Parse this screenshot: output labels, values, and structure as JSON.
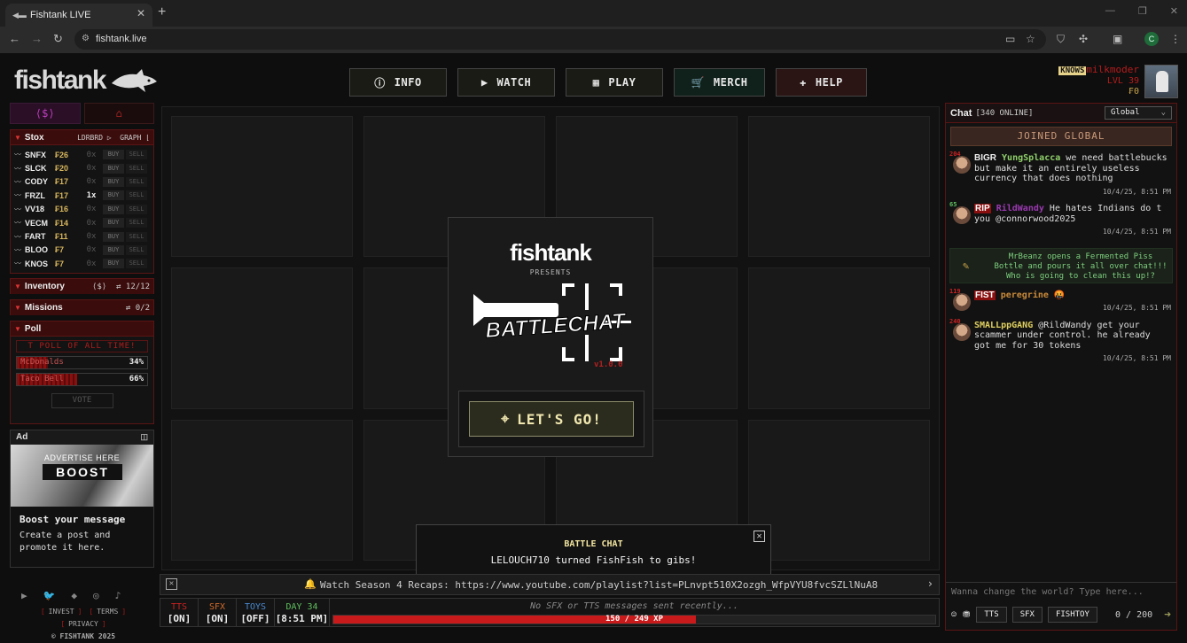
{
  "browser": {
    "tab_title": "Fishtank LIVE",
    "url": "fishtank.live"
  },
  "app": {
    "logo": "fishtank"
  },
  "nav": [
    {
      "label": "INFO",
      "icon": "info-icon",
      "glyph": "ⓘ"
    },
    {
      "label": "WATCH",
      "icon": "video-camera-icon",
      "glyph": "▶"
    },
    {
      "label": "PLAY",
      "icon": "checker-icon",
      "glyph": "▦"
    },
    {
      "label": "MERCH",
      "icon": "cart-icon",
      "glyph": "🛒"
    },
    {
      "label": "HELP",
      "icon": "help-icon",
      "glyph": "✚"
    }
  ],
  "nav_colors": [
    "#1b1b15",
    "#1b1b15",
    "#1b1b15",
    "#10201a",
    "#2a1414"
  ],
  "user": {
    "badge": "KNOWS",
    "name": "milkmoder",
    "level": "LVL 39",
    "coins": "₣0"
  },
  "stox": {
    "title": "Stox",
    "leaderboard": "LDRBRD ▷",
    "graph": "GRAPH ⌊",
    "rows": [
      {
        "sym": "SNFX",
        "price": "₣26",
        "qty": "0x",
        "own": false
      },
      {
        "sym": "SLCK",
        "price": "₣20",
        "qty": "0x",
        "own": false
      },
      {
        "sym": "CODY",
        "price": "₣17",
        "qty": "0x",
        "own": false
      },
      {
        "sym": "FRZL",
        "price": "₣17",
        "qty": "1x",
        "own": true
      },
      {
        "sym": "VV18",
        "price": "₣16",
        "qty": "0x",
        "own": false
      },
      {
        "sym": "VECM",
        "price": "₣14",
        "qty": "0x",
        "own": false
      },
      {
        "sym": "FART",
        "price": "₣11",
        "qty": "0x",
        "own": false
      },
      {
        "sym": "BLOO",
        "price": "₣7",
        "qty": "0x",
        "own": false
      },
      {
        "sym": "KNOS",
        "price": "₣7",
        "qty": "0x",
        "own": false
      }
    ],
    "buy": "BUY",
    "sell": "SELL"
  },
  "inventory": {
    "title": "Inventory",
    "count": "12/12"
  },
  "missions": {
    "title": "Missions",
    "count": "0/2"
  },
  "poll": {
    "title": "Poll",
    "question": "T POLL OF ALL TIME!",
    "options": [
      {
        "label": "McDonalds",
        "pct": "34%",
        "fraction": 0.34
      },
      {
        "label": "Taco Bell",
        "pct": "66%",
        "fraction": 0.66
      }
    ],
    "vote": "VOTE"
  },
  "ad": {
    "header": "Ad",
    "img_line1": "ADVERTISE HERE",
    "img_line2": "BOOST",
    "title": "Boost your message",
    "text": "Create a post and promote it here."
  },
  "footer": {
    "invest": "INVEST",
    "terms": "TERMS",
    "privacy": "PRIVACY",
    "copy": "© FISHTANK 2025"
  },
  "modal": {
    "logo": "fishtank",
    "presents": "PRESENTS",
    "art_text": "BATTLECHAT",
    "version": "v1.0.0",
    "button": "LET'S GO!"
  },
  "toast": {
    "title": "BATTLE CHAT",
    "message": "LELOUCH710 turned FishFish to gibs!"
  },
  "ticker": {
    "text": "Watch Season 4 Recaps: https://www.youtube.com/playlist?list=PLnvpt510X2ozgh_WfpVYU8fvcSZLlNuA8"
  },
  "status": {
    "tts": {
      "label": "TTS",
      "value": "[ON]",
      "color": "#c22"
    },
    "sfx": {
      "label": "SFX",
      "value": "[ON]",
      "color": "#d06a2a"
    },
    "toys": {
      "label": "TOYS",
      "value": "[OFF]",
      "color": "#4a8ad0"
    },
    "day": {
      "label": "DAY 34",
      "value": "[8:51 PM]",
      "color": "#5fbf5f"
    },
    "message": "No SFX or TTS messages sent recently...",
    "xp": "150 / 249 XP",
    "xp_fraction": 0.602
  },
  "chat": {
    "title": "Chat",
    "online": "[340 ONLINE]",
    "channel": "Global",
    "joined": "JOINED GLOBAL",
    "messages": [
      {
        "lvl": "204",
        "lvlColor": "red",
        "badge": "BIGR",
        "badgeStyle": "plain",
        "user": "YungSplacca",
        "userColor": "#8fd06a",
        "text": "we need battlebucks but make it an entirely useless currency that does nothing",
        "time": "10/4/25, 8:51 PM"
      },
      {
        "lvl": "65",
        "lvlColor": "green",
        "badge": "RIP",
        "badgeStyle": "red",
        "user": "RildWandy",
        "userColor": "#9a3ab0",
        "text": "He hates Indians do t you @connorwood2025",
        "time": "10/4/25, 8:51 PM"
      },
      {
        "lvl": "119",
        "lvlColor": "red",
        "badge": "FIST",
        "badgeStyle": "red",
        "user": "peregrine",
        "userColor": "#c98a3a",
        "text": "🤬",
        "time": "10/4/25, 8:51 PM"
      },
      {
        "lvl": "240",
        "lvlColor": "red",
        "badge": "",
        "badgeStyle": "plain",
        "user": "SMALLppGANG",
        "userColor": "#e0d060",
        "text": "@RildWandy get your scammer under control. he already got me for 30 tokens",
        "time": "10/4/25, 8:51 PM"
      }
    ],
    "system": "MrBeanz opens a Fermented Piss Bottle and pours it all over chat!!! Who is going to clean this up!?",
    "placeholder": "Wanna change the world? Type here...",
    "buttons": [
      "TTS",
      "SFX",
      "FISHTOY"
    ],
    "count": "0 / 200"
  }
}
